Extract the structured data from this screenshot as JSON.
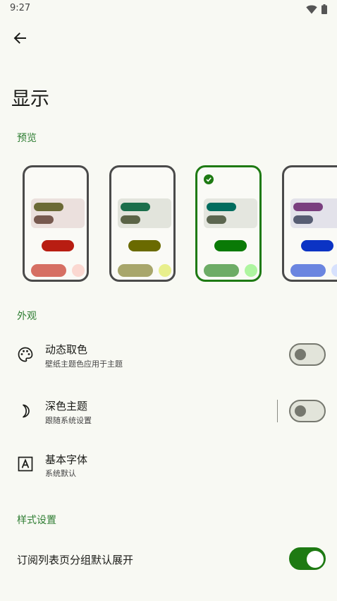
{
  "status_bar": {
    "time": "9:27",
    "icons": [
      "wifi-icon",
      "battery-icon"
    ]
  },
  "app_bar": {
    "back_icon": "arrow-left-icon"
  },
  "page": {
    "title": "显示"
  },
  "sections": {
    "preview": "预览",
    "appearance": "外观",
    "style": "样式设置"
  },
  "preview_themes": [
    {
      "selected": false,
      "panel": "#ebe0dd",
      "bar1": "#6b6a36",
      "bar2": "#77594f",
      "mid": "#b81d12",
      "wide": "#d66f63",
      "dot": "#fbd8d1"
    },
    {
      "selected": false,
      "panel": "#e2e4dc",
      "bar1": "#1a6e4b",
      "bar2": "#5b6447",
      "mid": "#6a6a00",
      "wide": "#a8a66b",
      "dot": "#e8ef8c"
    },
    {
      "selected": true,
      "panel": "#e4e6df",
      "bar1": "#006c5e",
      "bar2": "#5c6650",
      "mid": "#0a7a06",
      "wide": "#6dac66",
      "dot": "#aef5a0"
    },
    {
      "selected": false,
      "panel": "#e3e2ea",
      "bar1": "#7a3f7f",
      "bar2": "#575d73",
      "mid": "#0b33c4",
      "wide": "#6b85e0",
      "dot": "#d7e1fd"
    }
  ],
  "settings": {
    "dynamic_color": {
      "icon": "palette-icon",
      "title": "动态取色",
      "subtitle": "壁纸主题色应用于主题",
      "enabled": false
    },
    "dark_theme": {
      "icon": "moon-icon",
      "title": "深色主题",
      "subtitle": "跟随系统设置",
      "enabled": false
    },
    "base_font": {
      "icon": "font-icon",
      "title": "基本字体",
      "subtitle": "系统默认"
    },
    "group_expand": {
      "title": "订阅列表页分组默认展开",
      "enabled": true
    }
  },
  "colors": {
    "accent": "#1e7a13",
    "section_header": "#2e7d32",
    "background": "#f8f9f3"
  }
}
